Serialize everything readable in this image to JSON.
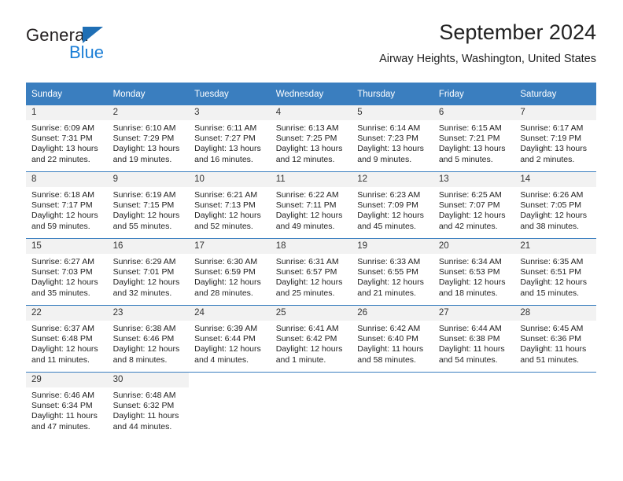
{
  "brand": {
    "name_top": "General",
    "name_bottom": "Blue",
    "accent_color": "#1b7ed6",
    "triangle_color": "#1f6fb5"
  },
  "header": {
    "title": "September 2024",
    "subtitle": "Airway Heights, Washington, United States"
  },
  "calendar": {
    "header_bg": "#3a7ebf",
    "daynum_bg": "#f2f2f2",
    "weekday_headers": [
      "Sunday",
      "Monday",
      "Tuesday",
      "Wednesday",
      "Thursday",
      "Friday",
      "Saturday"
    ],
    "weeks": [
      [
        {
          "day": "1",
          "sunrise": "Sunrise: 6:09 AM",
          "sunset": "Sunset: 7:31 PM",
          "daylight1": "Daylight: 13 hours",
          "daylight2": "and 22 minutes."
        },
        {
          "day": "2",
          "sunrise": "Sunrise: 6:10 AM",
          "sunset": "Sunset: 7:29 PM",
          "daylight1": "Daylight: 13 hours",
          "daylight2": "and 19 minutes."
        },
        {
          "day": "3",
          "sunrise": "Sunrise: 6:11 AM",
          "sunset": "Sunset: 7:27 PM",
          "daylight1": "Daylight: 13 hours",
          "daylight2": "and 16 minutes."
        },
        {
          "day": "4",
          "sunrise": "Sunrise: 6:13 AM",
          "sunset": "Sunset: 7:25 PM",
          "daylight1": "Daylight: 13 hours",
          "daylight2": "and 12 minutes."
        },
        {
          "day": "5",
          "sunrise": "Sunrise: 6:14 AM",
          "sunset": "Sunset: 7:23 PM",
          "daylight1": "Daylight: 13 hours",
          "daylight2": "and 9 minutes."
        },
        {
          "day": "6",
          "sunrise": "Sunrise: 6:15 AM",
          "sunset": "Sunset: 7:21 PM",
          "daylight1": "Daylight: 13 hours",
          "daylight2": "and 5 minutes."
        },
        {
          "day": "7",
          "sunrise": "Sunrise: 6:17 AM",
          "sunset": "Sunset: 7:19 PM",
          "daylight1": "Daylight: 13 hours",
          "daylight2": "and 2 minutes."
        }
      ],
      [
        {
          "day": "8",
          "sunrise": "Sunrise: 6:18 AM",
          "sunset": "Sunset: 7:17 PM",
          "daylight1": "Daylight: 12 hours",
          "daylight2": "and 59 minutes."
        },
        {
          "day": "9",
          "sunrise": "Sunrise: 6:19 AM",
          "sunset": "Sunset: 7:15 PM",
          "daylight1": "Daylight: 12 hours",
          "daylight2": "and 55 minutes."
        },
        {
          "day": "10",
          "sunrise": "Sunrise: 6:21 AM",
          "sunset": "Sunset: 7:13 PM",
          "daylight1": "Daylight: 12 hours",
          "daylight2": "and 52 minutes."
        },
        {
          "day": "11",
          "sunrise": "Sunrise: 6:22 AM",
          "sunset": "Sunset: 7:11 PM",
          "daylight1": "Daylight: 12 hours",
          "daylight2": "and 49 minutes."
        },
        {
          "day": "12",
          "sunrise": "Sunrise: 6:23 AM",
          "sunset": "Sunset: 7:09 PM",
          "daylight1": "Daylight: 12 hours",
          "daylight2": "and 45 minutes."
        },
        {
          "day": "13",
          "sunrise": "Sunrise: 6:25 AM",
          "sunset": "Sunset: 7:07 PM",
          "daylight1": "Daylight: 12 hours",
          "daylight2": "and 42 minutes."
        },
        {
          "day": "14",
          "sunrise": "Sunrise: 6:26 AM",
          "sunset": "Sunset: 7:05 PM",
          "daylight1": "Daylight: 12 hours",
          "daylight2": "and 38 minutes."
        }
      ],
      [
        {
          "day": "15",
          "sunrise": "Sunrise: 6:27 AM",
          "sunset": "Sunset: 7:03 PM",
          "daylight1": "Daylight: 12 hours",
          "daylight2": "and 35 minutes."
        },
        {
          "day": "16",
          "sunrise": "Sunrise: 6:29 AM",
          "sunset": "Sunset: 7:01 PM",
          "daylight1": "Daylight: 12 hours",
          "daylight2": "and 32 minutes."
        },
        {
          "day": "17",
          "sunrise": "Sunrise: 6:30 AM",
          "sunset": "Sunset: 6:59 PM",
          "daylight1": "Daylight: 12 hours",
          "daylight2": "and 28 minutes."
        },
        {
          "day": "18",
          "sunrise": "Sunrise: 6:31 AM",
          "sunset": "Sunset: 6:57 PM",
          "daylight1": "Daylight: 12 hours",
          "daylight2": "and 25 minutes."
        },
        {
          "day": "19",
          "sunrise": "Sunrise: 6:33 AM",
          "sunset": "Sunset: 6:55 PM",
          "daylight1": "Daylight: 12 hours",
          "daylight2": "and 21 minutes."
        },
        {
          "day": "20",
          "sunrise": "Sunrise: 6:34 AM",
          "sunset": "Sunset: 6:53 PM",
          "daylight1": "Daylight: 12 hours",
          "daylight2": "and 18 minutes."
        },
        {
          "day": "21",
          "sunrise": "Sunrise: 6:35 AM",
          "sunset": "Sunset: 6:51 PM",
          "daylight1": "Daylight: 12 hours",
          "daylight2": "and 15 minutes."
        }
      ],
      [
        {
          "day": "22",
          "sunrise": "Sunrise: 6:37 AM",
          "sunset": "Sunset: 6:48 PM",
          "daylight1": "Daylight: 12 hours",
          "daylight2": "and 11 minutes."
        },
        {
          "day": "23",
          "sunrise": "Sunrise: 6:38 AM",
          "sunset": "Sunset: 6:46 PM",
          "daylight1": "Daylight: 12 hours",
          "daylight2": "and 8 minutes."
        },
        {
          "day": "24",
          "sunrise": "Sunrise: 6:39 AM",
          "sunset": "Sunset: 6:44 PM",
          "daylight1": "Daylight: 12 hours",
          "daylight2": "and 4 minutes."
        },
        {
          "day": "25",
          "sunrise": "Sunrise: 6:41 AM",
          "sunset": "Sunset: 6:42 PM",
          "daylight1": "Daylight: 12 hours",
          "daylight2": "and 1 minute."
        },
        {
          "day": "26",
          "sunrise": "Sunrise: 6:42 AM",
          "sunset": "Sunset: 6:40 PM",
          "daylight1": "Daylight: 11 hours",
          "daylight2": "and 58 minutes."
        },
        {
          "day": "27",
          "sunrise": "Sunrise: 6:44 AM",
          "sunset": "Sunset: 6:38 PM",
          "daylight1": "Daylight: 11 hours",
          "daylight2": "and 54 minutes."
        },
        {
          "day": "28",
          "sunrise": "Sunrise: 6:45 AM",
          "sunset": "Sunset: 6:36 PM",
          "daylight1": "Daylight: 11 hours",
          "daylight2": "and 51 minutes."
        }
      ],
      [
        {
          "day": "29",
          "sunrise": "Sunrise: 6:46 AM",
          "sunset": "Sunset: 6:34 PM",
          "daylight1": "Daylight: 11 hours",
          "daylight2": "and 47 minutes."
        },
        {
          "day": "30",
          "sunrise": "Sunrise: 6:48 AM",
          "sunset": "Sunset: 6:32 PM",
          "daylight1": "Daylight: 11 hours",
          "daylight2": "and 44 minutes."
        },
        {
          "day": "",
          "sunrise": "",
          "sunset": "",
          "daylight1": "",
          "daylight2": ""
        },
        {
          "day": "",
          "sunrise": "",
          "sunset": "",
          "daylight1": "",
          "daylight2": ""
        },
        {
          "day": "",
          "sunrise": "",
          "sunset": "",
          "daylight1": "",
          "daylight2": ""
        },
        {
          "day": "",
          "sunrise": "",
          "sunset": "",
          "daylight1": "",
          "daylight2": ""
        },
        {
          "day": "",
          "sunrise": "",
          "sunset": "",
          "daylight1": "",
          "daylight2": ""
        }
      ]
    ]
  }
}
